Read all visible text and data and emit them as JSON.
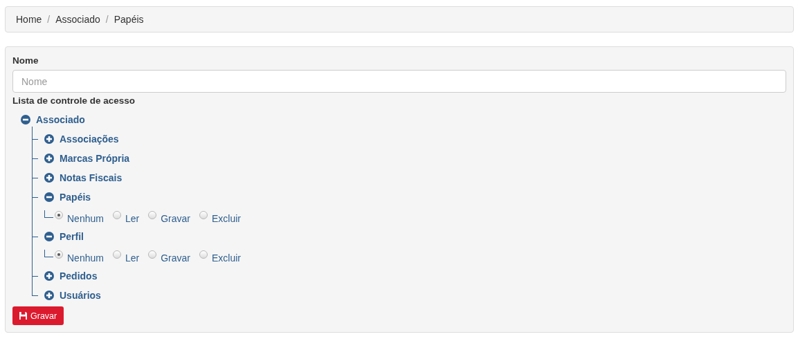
{
  "breadcrumb_separator": "/",
  "breadcrumb": [
    {
      "label": "Home"
    },
    {
      "label": "Associado"
    },
    {
      "label": "Papéis"
    }
  ],
  "form": {
    "name_label": "Nome",
    "name_placeholder": "Nome",
    "acl_label": "Lista de controle de acesso"
  },
  "tree": [
    {
      "label": "Associado",
      "expanded": true,
      "children": [
        {
          "label": "Associações",
          "expanded": false
        },
        {
          "label": "Marcas Própria",
          "expanded": false
        },
        {
          "label": "Notas Fiscais",
          "expanded": false
        },
        {
          "label": "Papéis",
          "expanded": true,
          "permissions": [
            {
              "label": "Nenhum",
              "selected": true
            },
            {
              "label": "Ler",
              "selected": false
            },
            {
              "label": "Gravar",
              "selected": false
            },
            {
              "label": "Excluir",
              "selected": false
            }
          ]
        },
        {
          "label": "Perfil",
          "expanded": true,
          "permissions": [
            {
              "label": "Nenhum",
              "selected": true
            },
            {
              "label": "Ler",
              "selected": false
            },
            {
              "label": "Gravar",
              "selected": false
            },
            {
              "label": "Excluir",
              "selected": false
            }
          ]
        },
        {
          "label": "Pedidos",
          "expanded": false
        },
        {
          "label": "Usuários",
          "expanded": false
        }
      ]
    }
  ],
  "save_button": {
    "label": "Gravar"
  }
}
